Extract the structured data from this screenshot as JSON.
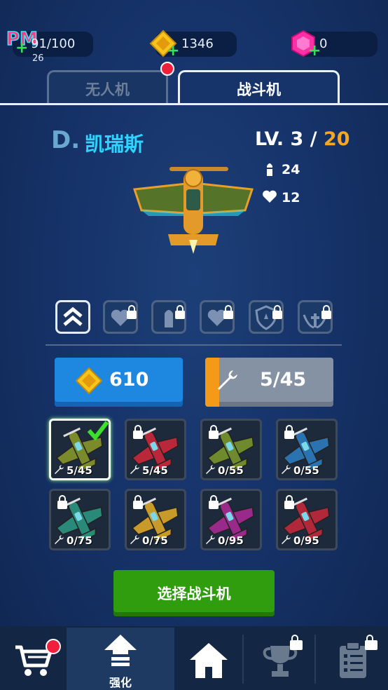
{
  "resources": {
    "energy": "91/100",
    "energy_timer": "26",
    "gold": "1346",
    "gems": "0"
  },
  "tabs": {
    "drone": "无人机",
    "fighter": "战斗机"
  },
  "plane": {
    "rank": "D.",
    "name": "凯瑞斯",
    "level_prefix": "LV. 3 / ",
    "level_max": "20",
    "attack": "24",
    "health": "12"
  },
  "upgrade": {
    "gold_cost": "610",
    "parts": "5/45",
    "parts_fill": 0.11
  },
  "planes": [
    {
      "count": "5/45",
      "color": "#7b8a2a",
      "selected": true,
      "locked": false
    },
    {
      "count": "5/45",
      "color": "#b8283a",
      "selected": false,
      "locked": true
    },
    {
      "count": "0/55",
      "color": "#6f8a2c",
      "selected": false,
      "locked": true
    },
    {
      "count": "0/55",
      "color": "#2a73b0",
      "selected": false,
      "locked": true
    },
    {
      "count": "0/75",
      "color": "#2a8a7a",
      "selected": false,
      "locked": true
    },
    {
      "count": "0/75",
      "color": "#c89a2a",
      "selected": false,
      "locked": true
    },
    {
      "count": "0/95",
      "color": "#9a2a8a",
      "selected": false,
      "locked": true
    },
    {
      "count": "0/95",
      "color": "#b0283a",
      "selected": false,
      "locked": true
    }
  ],
  "select_button": "选择战斗机",
  "nav": {
    "upgrade_label": "强化"
  },
  "colors": {
    "accent_cyan": "#2fd3ff",
    "level_gold": "#f5a623",
    "select_green": "#2f9d0e",
    "gold_blue": "#1e87e0"
  }
}
